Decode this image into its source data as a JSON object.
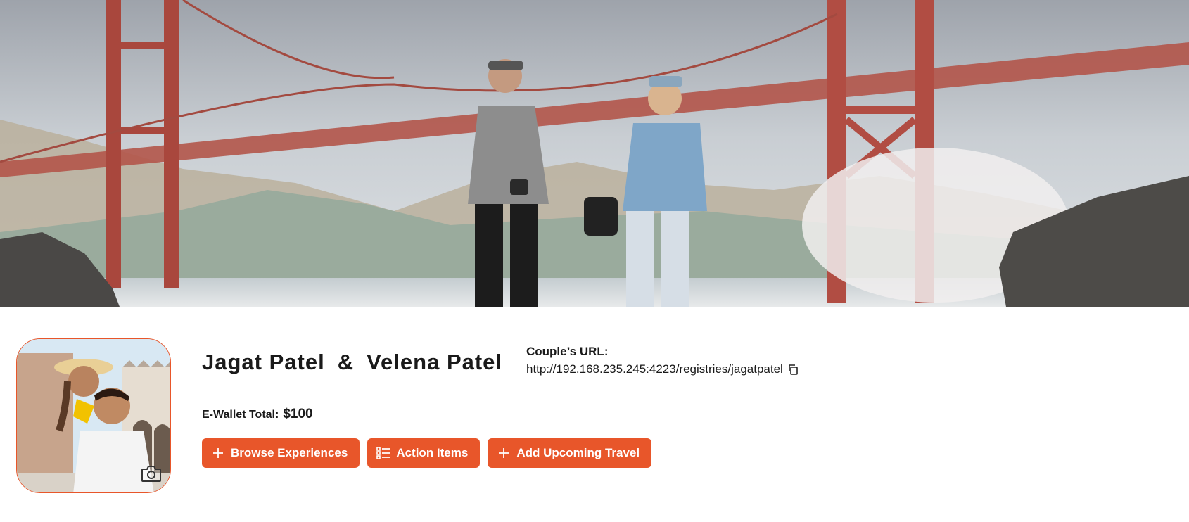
{
  "hero": {
    "image": "couple-walking-golden-gate-bridge"
  },
  "profile": {
    "photo": "couple-piggyback-portrait",
    "camera_icon": "camera-icon"
  },
  "couple": {
    "partner1": "Jagat Patel",
    "separator": "&",
    "partner2": "Velena Patel"
  },
  "couple_url": {
    "label": "Couple’s URL:",
    "url": "http://192.168.235.245:4223/registries/jagatpatel",
    "copy_icon": "copy-icon"
  },
  "wallet": {
    "label": "E-Wallet Total:",
    "value": "$100"
  },
  "actions": {
    "browse": {
      "label": "Browse Experiences",
      "icon": "plus-icon"
    },
    "action_items": {
      "label": "Action Items",
      "icon": "checklist-icon"
    },
    "add_travel": {
      "label": "Add Upcoming Travel",
      "icon": "plus-icon"
    }
  },
  "colors": {
    "accent": "#e8562a",
    "text": "#1a1a1a",
    "divider": "#c8c8c8"
  }
}
